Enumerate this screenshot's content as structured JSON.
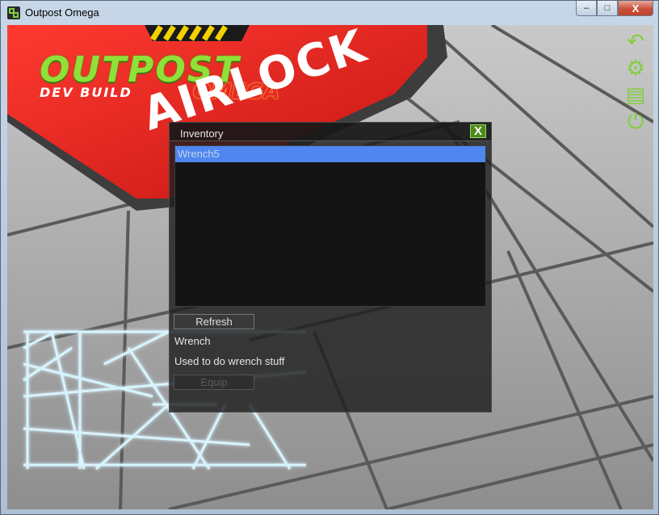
{
  "window": {
    "title": "Outpost Omega",
    "controls": {
      "minimize": "–",
      "maximize": "□",
      "close": "X"
    }
  },
  "game": {
    "logo": {
      "main": "OUTPOST",
      "sub": "OMEGA",
      "tag": "DEV BUILD"
    },
    "floor_sign": "AIRLOCK",
    "hud_icons": [
      "undo-icon",
      "gear-icon",
      "save-icon",
      "power-icon"
    ],
    "colors": {
      "accent_green": "#7fd03a",
      "sign_red": "#e8201e",
      "selection_blue": "#4f86f0"
    }
  },
  "inventory": {
    "title": "Inventory",
    "close_label": "X",
    "items": [
      {
        "label": "Wrench5",
        "selected": true
      }
    ],
    "refresh_label": "Refresh",
    "item_name": "Wrench",
    "item_description": "Used to do wrench stuff",
    "equip_label": "Equip"
  }
}
